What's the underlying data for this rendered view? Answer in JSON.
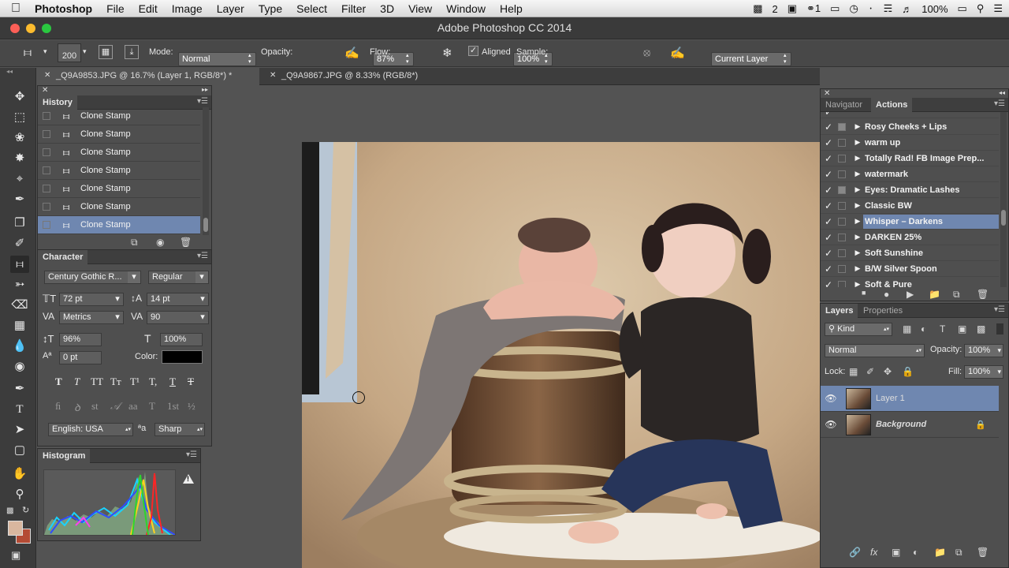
{
  "menubar": {
    "app": "Photoshop",
    "items": [
      "File",
      "Edit",
      "Image",
      "Layer",
      "Type",
      "Select",
      "Filter",
      "3D",
      "View",
      "Window",
      "Help"
    ],
    "status_num": "2",
    "badge_num": "1",
    "battery": "100%"
  },
  "window": {
    "title": "Adobe Photoshop CC 2014"
  },
  "options": {
    "brush_size": "200",
    "mode_label": "Mode:",
    "mode_value": "Normal",
    "opacity_label": "Opacity:",
    "opacity_value": "87%",
    "flow_label": "Flow:",
    "flow_value": "100%",
    "aligned_label": "Aligned",
    "aligned_checked": "✓",
    "sample_label": "Sample:",
    "sample_value": "Current Layer"
  },
  "tabs": [
    {
      "label": "_Q9A9853.JPG @ 16.7% (Layer 1, RGB/8*) *"
    },
    {
      "label": "_Q9A9867.JPG @ 8.33% (RGB/8*)"
    }
  ],
  "history": {
    "title": "History",
    "items": [
      "Clone Stamp",
      "Clone Stamp",
      "Clone Stamp",
      "Clone Stamp",
      "Clone Stamp",
      "Clone Stamp",
      "Clone Stamp"
    ]
  },
  "character": {
    "title": "Character",
    "font_family": "Century Gothic R...",
    "font_style": "Regular",
    "size": "72 pt",
    "leading": "14 pt",
    "kerning": "Metrics",
    "tracking": "90",
    "vscale": "96%",
    "hscale": "100%",
    "baseline": "0 pt",
    "color_label": "Color:",
    "glyphs1": [
      "T",
      "T",
      "TT",
      "Tт",
      "T¹",
      "T,",
      "T",
      "T"
    ],
    "glyphs2": [
      "ﬁ",
      "ꝺ",
      "st",
      "𝒜",
      "aa",
      "T",
      "1st",
      "½"
    ],
    "language": "English: USA",
    "aa_icon": "ªa",
    "antialias": "Sharp"
  },
  "histogram": {
    "title": "Histogram",
    "warning": "!"
  },
  "navigator_tab": "Navigator",
  "actions": {
    "title": "Actions",
    "items": [
      "Rosy Cheeks + Lips",
      "warm up",
      "Totally Rad! FB Image Prep...",
      "watermark",
      "Eyes: Dramatic Lashes",
      "Classic BW",
      "Whisper – Darkens",
      "DARKEN 25%",
      "Soft Sunshine",
      "B/W Silver Spoon",
      "Soft & Pure"
    ]
  },
  "layers": {
    "title": "Layers",
    "properties_tab": "Properties",
    "kind": "Kind",
    "blend": "Normal",
    "opacity_label": "Opacity:",
    "opacity": "100%",
    "lock_label": "Lock:",
    "fill_label": "Fill:",
    "fill": "100%",
    "items": [
      {
        "name": "Layer 1"
      },
      {
        "name": "Background"
      }
    ]
  },
  "colors": {
    "accent_selected": "#6f87b0",
    "foreground_swatch": "#d9b79f",
    "background_swatch": "#b44b34"
  }
}
